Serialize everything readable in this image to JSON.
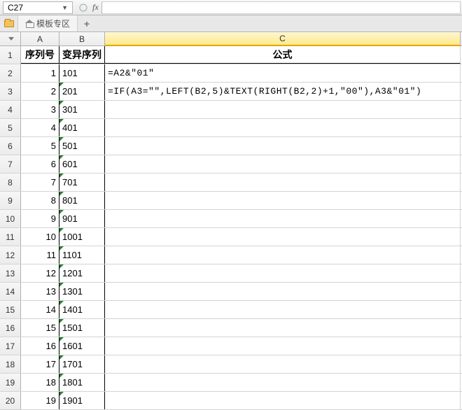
{
  "namebox": {
    "ref": "C27"
  },
  "formula_bar": {
    "fx_label": "fx",
    "value": ""
  },
  "tabs": {
    "template_label": "模板专区",
    "add_label": "+"
  },
  "columns": {
    "A": "A",
    "B": "B",
    "C": "C"
  },
  "headers": {
    "A": "序列号",
    "B": "变异序列",
    "C": "公式"
  },
  "rows": [
    {
      "n": "1",
      "A": "1",
      "B": "101",
      "C": "=A2&\"01\"",
      "flagB": false
    },
    {
      "n": "2",
      "A": "2",
      "B": "201",
      "C": "=IF(A3=\"\",LEFT(B2,5)&TEXT(RIGHT(B2,2)+1,\"00\"),A3&\"01\")",
      "flagB": true
    },
    {
      "n": "3",
      "A": "3",
      "B": "301",
      "C": "",
      "flagB": true
    },
    {
      "n": "4",
      "A": "4",
      "B": "401",
      "C": "",
      "flagB": true
    },
    {
      "n": "5",
      "A": "5",
      "B": "501",
      "C": "",
      "flagB": true
    },
    {
      "n": "6",
      "A": "6",
      "B": "601",
      "C": "",
      "flagB": true
    },
    {
      "n": "7",
      "A": "7",
      "B": "701",
      "C": "",
      "flagB": true
    },
    {
      "n": "8",
      "A": "8",
      "B": "801",
      "C": "",
      "flagB": true
    },
    {
      "n": "9",
      "A": "9",
      "B": "901",
      "C": "",
      "flagB": true
    },
    {
      "n": "10",
      "A": "10",
      "B": "1001",
      "C": "",
      "flagB": true
    },
    {
      "n": "11",
      "A": "11",
      "B": "1101",
      "C": "",
      "flagB": true
    },
    {
      "n": "12",
      "A": "12",
      "B": "1201",
      "C": "",
      "flagB": true
    },
    {
      "n": "13",
      "A": "13",
      "B": "1301",
      "C": "",
      "flagB": true
    },
    {
      "n": "14",
      "A": "14",
      "B": "1401",
      "C": "",
      "flagB": true
    },
    {
      "n": "15",
      "A": "15",
      "B": "1501",
      "C": "",
      "flagB": true
    },
    {
      "n": "16",
      "A": "16",
      "B": "1601",
      "C": "",
      "flagB": true
    },
    {
      "n": "17",
      "A": "17",
      "B": "1701",
      "C": "",
      "flagB": true
    },
    {
      "n": "18",
      "A": "18",
      "B": "1801",
      "C": "",
      "flagB": true
    },
    {
      "n": "19",
      "A": "19",
      "B": "1901",
      "C": "",
      "flagB": true
    }
  ]
}
